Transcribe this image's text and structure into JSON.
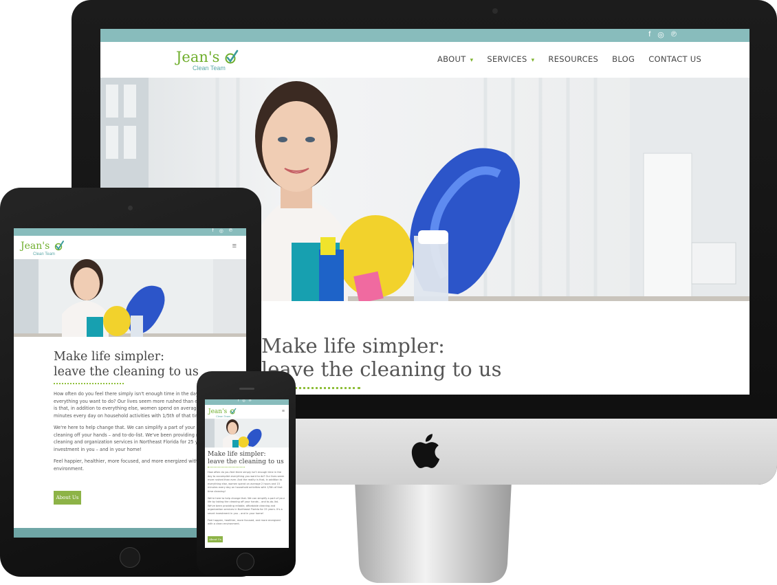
{
  "brand": {
    "logo_main": "Jean's",
    "logo_sub": "Clean Team",
    "green": "#6fae2c",
    "teal": "#88bcbc"
  },
  "social": {
    "facebook": "f",
    "instagram": "◎",
    "pinterest": "℗"
  },
  "nav": {
    "about": "ABOUT",
    "services": "SERVICES",
    "resources": "RESOURCES",
    "blog": "BLOG",
    "contact": "CONTACT US",
    "menu_icon": "≡"
  },
  "hero": {
    "headline_line1": "Make life simpler:",
    "headline_line2": "leave the cleaning to us"
  },
  "content": {
    "paragraph1": "How often do you feel there simply isn't enough time in the day to accomplish everything you want to do? Our lives seem more rushed than ever. And the reality is that, in addition to everything else, women spend on average 2 hours and 15 minutes every day on household activities with 1/5th of that time cleaning!",
    "paragraph2": "We're here to help change that. We can simplify a part of your life by taking the cleaning off your hands – and to-do-list. We've been providing reliable, affordable cleaning and organization services in Northeast Florida for 25 years. It's a smart investment in you – and in your home!",
    "paragraph3": "Feel happier, healthier, more focused, and more energized with a clean environment.",
    "button": "About Us"
  }
}
